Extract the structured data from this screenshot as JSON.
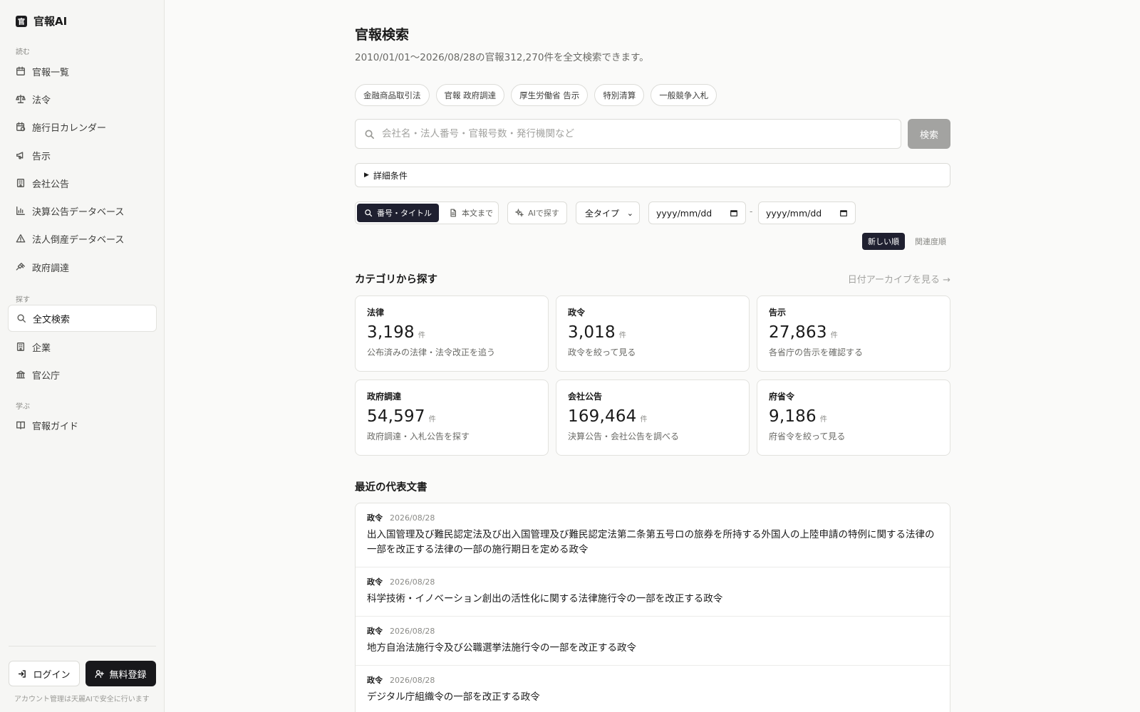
{
  "brand": {
    "name": "官報AI",
    "mark": "官"
  },
  "sidebar": {
    "section_read": "読む",
    "section_search": "探す",
    "section_learn": "学ぶ",
    "items": [
      {
        "label": "官報一覧",
        "icon": "calendar-icon"
      },
      {
        "label": "法令",
        "icon": "scale-icon"
      },
      {
        "label": "施行日カレンダー",
        "icon": "calendar-clock-icon"
      },
      {
        "label": "告示",
        "icon": "megaphone-icon"
      },
      {
        "label": "会社公告",
        "icon": "building-icon"
      },
      {
        "label": "決算公告データベース",
        "icon": "bar-chart-icon"
      },
      {
        "label": "法人倒産データベース",
        "icon": "warning-icon"
      },
      {
        "label": "政府調達",
        "icon": "gavel-icon"
      },
      {
        "label": "全文検索",
        "icon": "search-icon",
        "active": true
      },
      {
        "label": "企業",
        "icon": "building-icon"
      },
      {
        "label": "官公庁",
        "icon": "landmark-icon"
      },
      {
        "label": "官報ガイド",
        "icon": "book-icon"
      }
    ],
    "login_label": "ログイン",
    "signup_label": "無料登録",
    "note": "アカウント管理は天麗AIで安全に行います"
  },
  "main": {
    "title": "官報検索",
    "subtitle": "2010/01/01〜2026/08/28の官報312,270件を全文検索できます。",
    "chips": [
      "金融商品取引法",
      "官報 政府調達",
      "厚生労働省 告示",
      "特別清算",
      "一般競争入札"
    ],
    "search": {
      "placeholder": "会社名・法人番号・官報号数・発行機関など",
      "value": "",
      "button_label": "検索"
    },
    "details_label": "詳細条件",
    "mode": {
      "title_label": "番号・タイトル",
      "body_label": "本文まで",
      "ai_label": "AIで探す"
    },
    "type_select": {
      "selected": "全タイプ"
    },
    "date_from": "yyyy/mm/dd",
    "date_sep": "-",
    "date_to": "yyyy/mm/dd",
    "sort": {
      "newest_label": "新しい順",
      "relevance_label": "関連度順"
    },
    "category_title": "カテゴリから探す",
    "archive_link": "日付アーカイブを見る →",
    "categories": [
      {
        "title": "法律",
        "count": "3,198",
        "unit": "件",
        "desc": "公布済みの法律・法令改正を追う"
      },
      {
        "title": "政令",
        "count": "3,018",
        "unit": "件",
        "desc": "政令を絞って見る"
      },
      {
        "title": "告示",
        "count": "27,863",
        "unit": "件",
        "desc": "各省庁の告示を確認する"
      },
      {
        "title": "政府調達",
        "count": "54,597",
        "unit": "件",
        "desc": "政府調達・入札公告を探す"
      },
      {
        "title": "会社公告",
        "count": "169,464",
        "unit": "件",
        "desc": "決算公告・会社公告を調べる"
      },
      {
        "title": "府省令",
        "count": "9,186",
        "unit": "件",
        "desc": "府省令を絞って見る"
      }
    ],
    "recent_title": "最近の代表文書",
    "recent_docs": [
      {
        "type": "政令",
        "date": "2026/08/28",
        "title": "出入国管理及び難民認定法及び出入国管理及び難民認定法第二条第五号ロの旅券を所持する外国人の上陸申請の特例に関する法律の一部を改正する法律の一部の施行期日を定める政令"
      },
      {
        "type": "政令",
        "date": "2026/08/28",
        "title": "科学技術・イノベーション創出の活性化に関する法律施行令の一部を改正する政令"
      },
      {
        "type": "政令",
        "date": "2026/08/28",
        "title": "地方自治法施行令及び公職選挙法施行令の一部を改正する政令"
      },
      {
        "type": "政令",
        "date": "2026/08/28",
        "title": "デジタル庁組織令の一部を改正する政令"
      }
    ]
  }
}
